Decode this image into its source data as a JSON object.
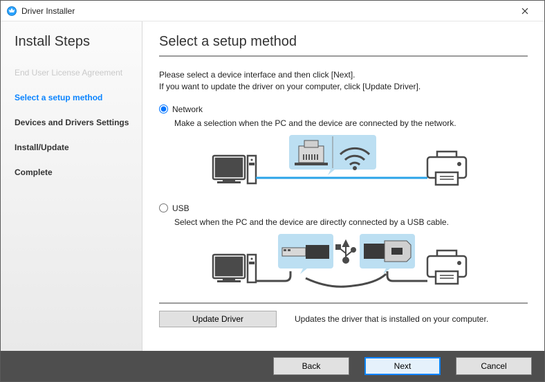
{
  "window": {
    "title": "Driver Installer"
  },
  "sidebar": {
    "heading": "Install Steps",
    "steps": [
      {
        "label": "End User License Agreement",
        "state": "muted"
      },
      {
        "label": "Select a setup method",
        "state": "active"
      },
      {
        "label": "Devices and Drivers Settings",
        "state": "normal"
      },
      {
        "label": "Install/Update",
        "state": "normal"
      },
      {
        "label": "Complete",
        "state": "normal"
      }
    ]
  },
  "main": {
    "heading": "Select a setup method",
    "instruction_line1": "Please select a device interface and then click [Next].",
    "instruction_line2": "If you want to update the driver on your computer, click [Update Driver].",
    "options": {
      "network": {
        "label": "Network",
        "selected": true,
        "description": "Make a selection when the PC and the device are connected by the network."
      },
      "usb": {
        "label": "USB",
        "selected": false,
        "description": "Select when the PC and the device are directly connected by a USB cable."
      }
    },
    "update": {
      "button_label": "Update Driver",
      "note": "Updates the driver that is installed on your computer."
    }
  },
  "footer": {
    "back_label": "Back",
    "next_label": "Next",
    "cancel_label": "Cancel"
  }
}
